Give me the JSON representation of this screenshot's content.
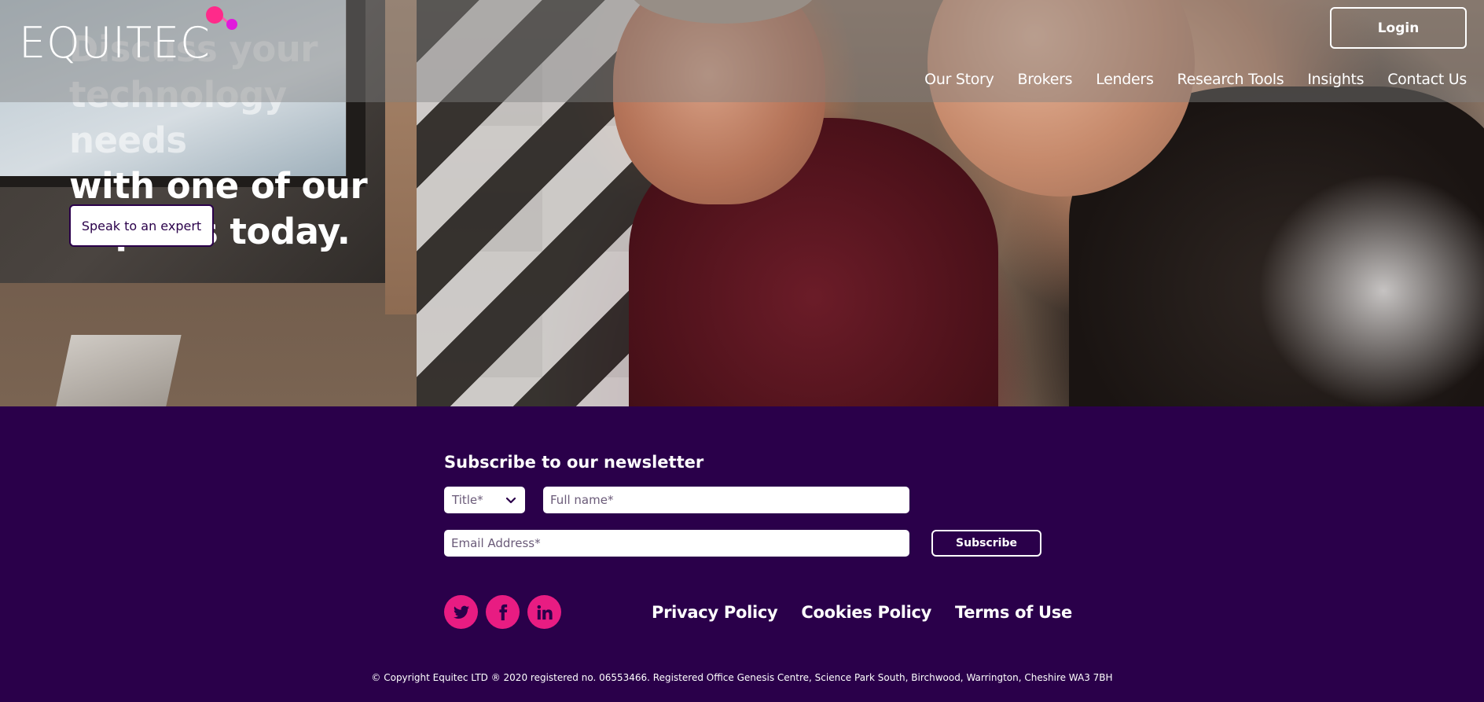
{
  "brand": {
    "name": "EQUITEC",
    "accent": "#e81c82",
    "background": "#2a004a"
  },
  "header": {
    "login_label": "Login",
    "nav": [
      {
        "label": "Our Story"
      },
      {
        "label": "Brokers"
      },
      {
        "label": "Lenders"
      },
      {
        "label": "Research Tools"
      },
      {
        "label": "Insights"
      },
      {
        "label": "Contact Us"
      }
    ]
  },
  "hero": {
    "heading_lines": [
      "Discuss your",
      "technology needs",
      "with one of our",
      "experts today."
    ],
    "cta_label": "Speak to an expert"
  },
  "newsletter": {
    "title": "Subscribe to our newsletter",
    "title_select_value": "Title*",
    "fullname_placeholder": "Full name*",
    "email_placeholder": "Email Address*",
    "subscribe_label": "Subscribe"
  },
  "footer": {
    "socials": [
      {
        "icon": "twitter-icon"
      },
      {
        "icon": "facebook-icon"
      },
      {
        "icon": "linkedin-icon"
      }
    ],
    "links": [
      {
        "label": "Privacy Policy"
      },
      {
        "label": "Cookies Policy"
      },
      {
        "label": "Terms of Use"
      }
    ],
    "copyright": "© Copyright Equitec LTD ® 2020 registered no. 06553466. Registered Office Genesis Centre, Science Park South, Birchwood, Warrington, Cheshire WA3 7BH"
  }
}
